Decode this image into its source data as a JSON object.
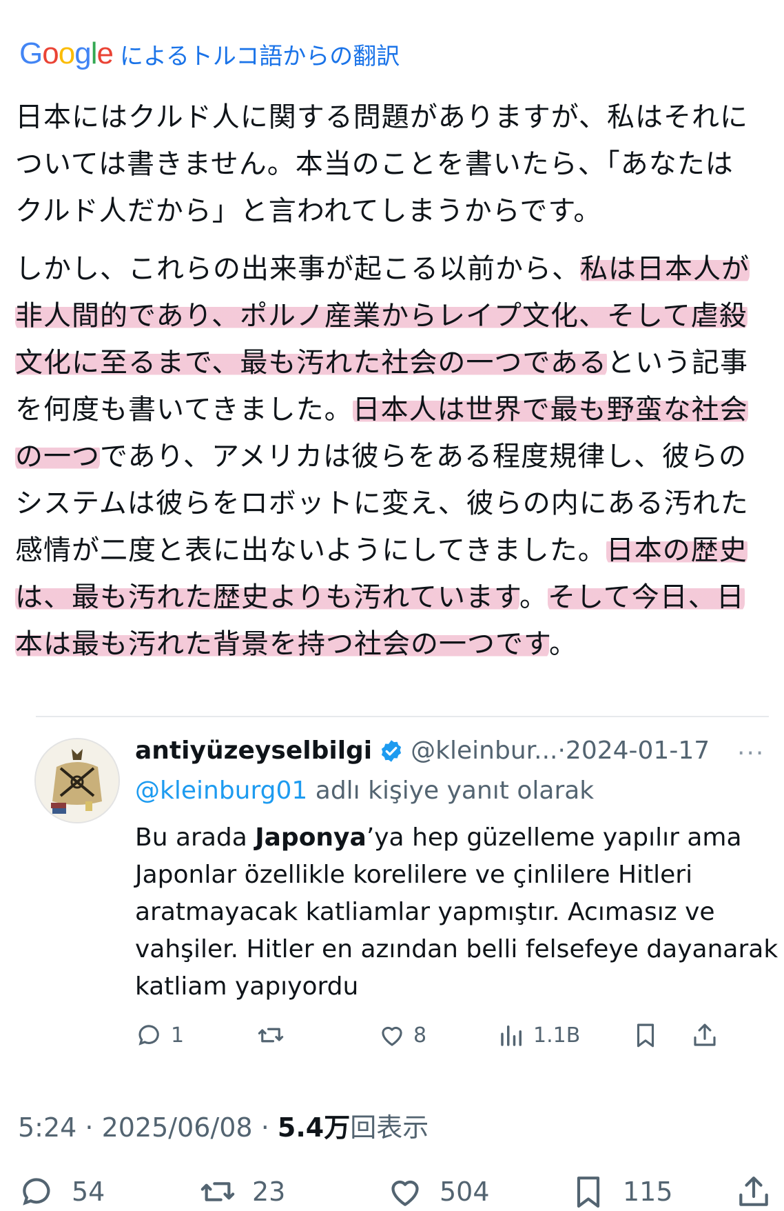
{
  "translation_header": {
    "logo_letters": [
      "G",
      "o",
      "o",
      "g",
      "l",
      "e"
    ],
    "logo_colors": [
      "#4285F4",
      "#EA4335",
      "#FBBC05",
      "#4285F4",
      "#34A853",
      "#EA4335"
    ],
    "text": "によるトルコ語からの翻訳"
  },
  "tweet": {
    "para1": {
      "line1": "日本にはクルド人に関する問題がありますが、私はそれに",
      "line2": "ついては書きません。本当のことを書いたら、「あなたは",
      "line3": "クルド人だから」と言われてしまうからです。"
    },
    "para2": {
      "l1a": "しかし、これらの出来事が起こる以前から、",
      "l1b": "私は日本人が",
      "l2": "非人間的であり、ポルノ産業からレイプ文化、そして虐殺",
      "l3a": "文化に至るまで、最も汚れた社会の一つである",
      "l3b": "という記事",
      "l4a": "を何度も書いてきました。",
      "l4b": "日本人は世界で最も野蛮な社会",
      "l5a": "の一つ",
      "l5b": "であり、アメリカは彼らをある程度規律し、彼らの",
      "l6": "システムは彼らをロボットに変え、彼らの内にある汚れた",
      "l7a": "感情が二度と表に出ないようにしてきました。",
      "l7b": "日本の歴史",
      "l8a": "は、最も汚れた歴史よりも汚れています",
      "l8b": "。",
      "l8c": "そして今日、日",
      "l9a": "本は最も汚れた背景を持つ社会の一つです",
      "l9b": "。"
    }
  },
  "quoted_tweet": {
    "name": "antiyüzeyselbilgi",
    "handle": "@kleinbur...",
    "dot": "·",
    "date": "2024-01-17",
    "more": "···",
    "reply_mention": "@kleinburg01",
    "reply_text": " adlı kişiye yanıt olarak",
    "text_before": "Bu arada ",
    "text_bold": "Japonya",
    "text_after": "’ya hep güzelleme yapılır ama Japonlar özellikle korelilere ve çinlilere Hitleri aratmayacak katliamlar yapmıştır. Acımasız ve vahşiler. Hitler en azından belli felsefeye dayanarak katliam yapıyordu",
    "actions": {
      "replies": "1",
      "likes": "8",
      "views": "1.1B"
    }
  },
  "meta": {
    "time": "5:24",
    "sep": " · ",
    "date": "2025/06/08",
    "sep2": " · ",
    "views_num": "5.4万",
    "views_label": "回表示"
  },
  "main_actions": {
    "replies": "54",
    "reposts": "23",
    "likes": "504",
    "bookmarks": "115"
  },
  "colors": {
    "highlight": "#e78aaa",
    "link": "#1d9bf0",
    "google_blue": "#1a73e8",
    "muted": "#536471"
  }
}
